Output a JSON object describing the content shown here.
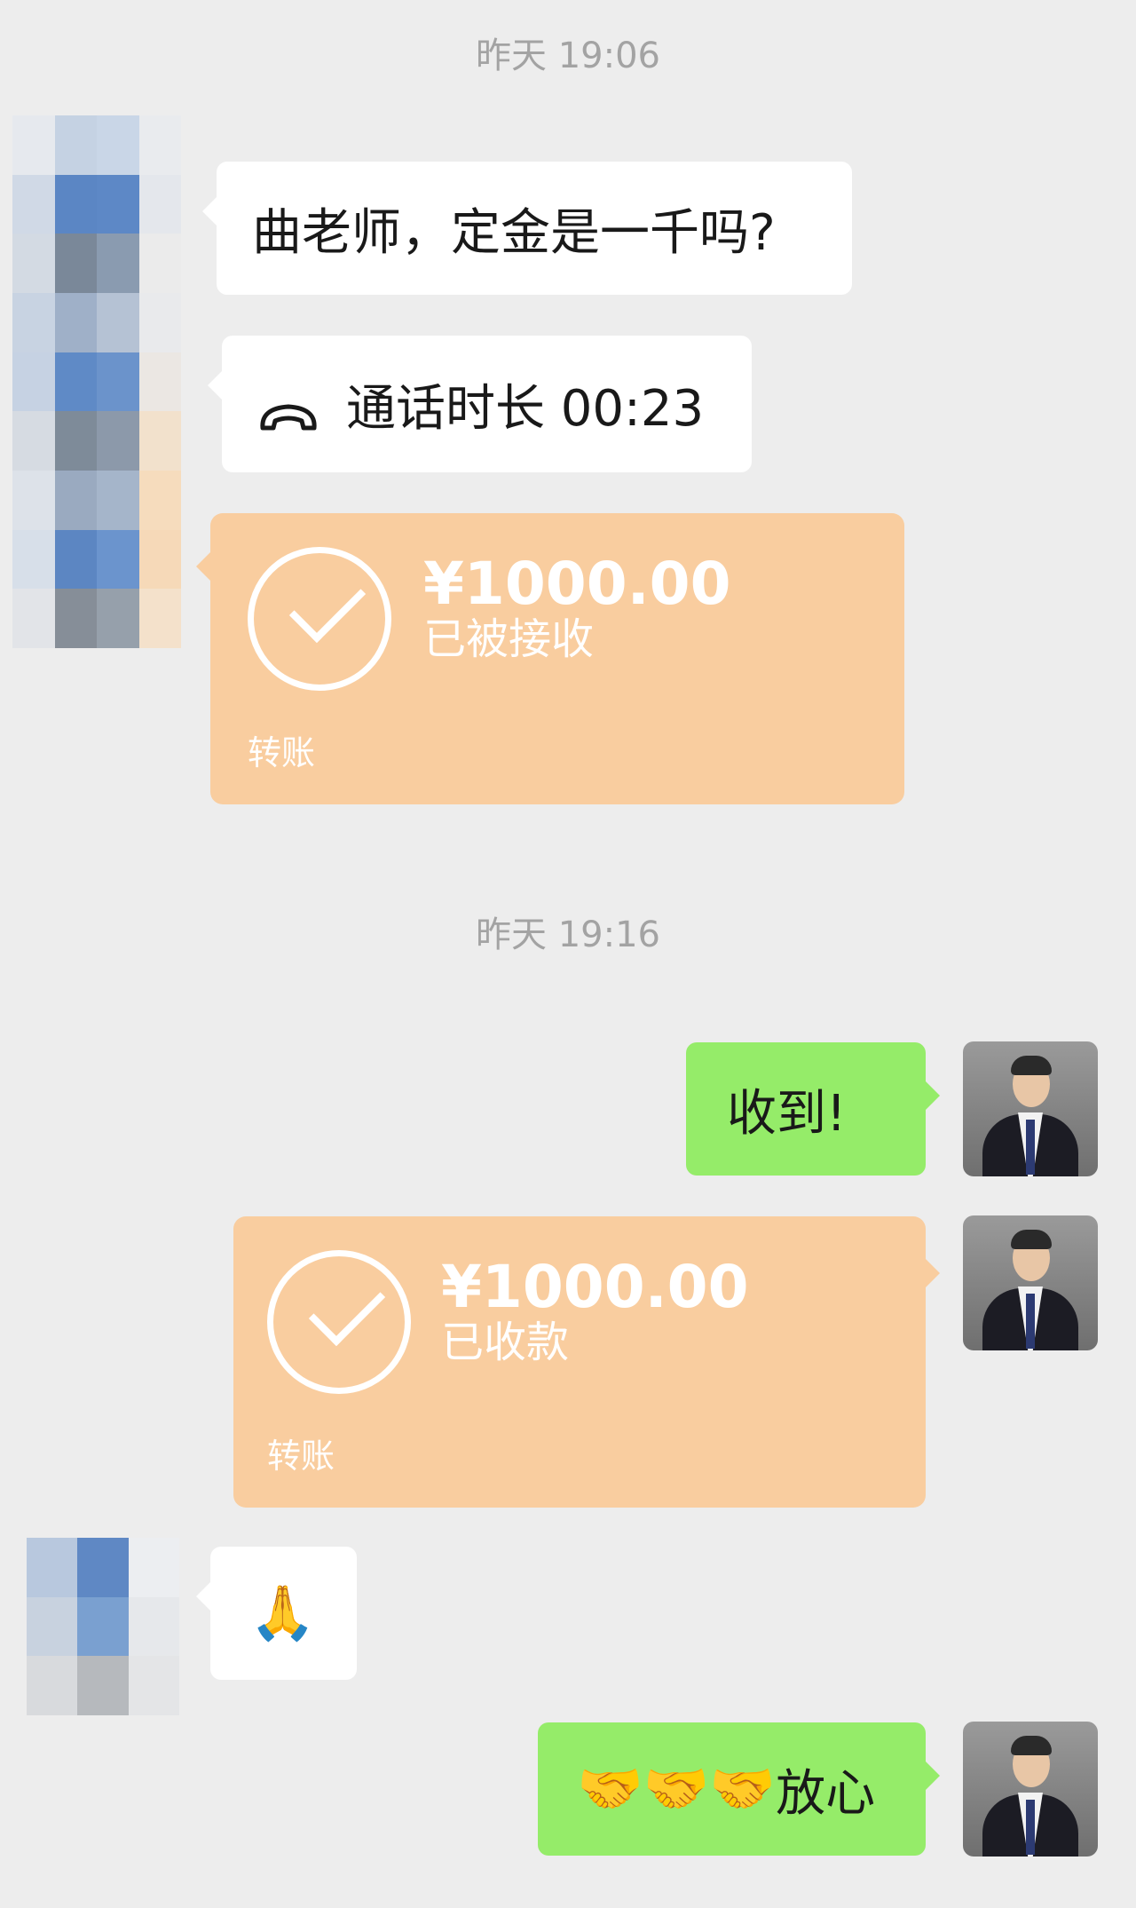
{
  "timestamps": [
    "昨天 19:06",
    "昨天 19:16"
  ],
  "messages": {
    "question": "曲老师，定金是一千吗?",
    "call_duration": "通话时长 00:23",
    "received_reply": "收到!",
    "thumbs_emoji": "🙏",
    "reassure_emojis": "🤝🤝🤝",
    "reassure_text": "放心"
  },
  "transfer_sent": {
    "amount": "¥1000.00",
    "status": "已被接收",
    "type": "转账"
  },
  "transfer_received": {
    "amount": "¥1000.00",
    "status": "已收款",
    "type": "转账"
  },
  "colors": {
    "background": "#ededed",
    "incoming_bubble": "#ffffff",
    "outgoing_bubble": "#95ec69",
    "transfer_card": "#f9cd9f"
  },
  "icons": {
    "call": "phone-hangup-icon",
    "transfer": "check-circle-icon"
  }
}
